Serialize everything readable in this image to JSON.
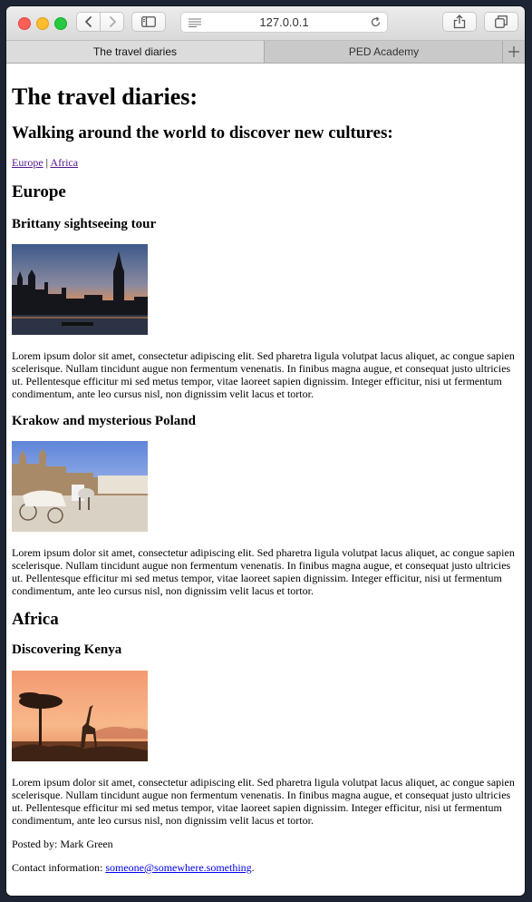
{
  "browser": {
    "url": "127.0.0.1",
    "tabs": [
      {
        "label": "The travel diaries",
        "active": true
      },
      {
        "label": "PED Academy",
        "active": false
      }
    ]
  },
  "page": {
    "title": "The travel diaries:",
    "subtitle": "Walking around the world to discover new cultures:",
    "nav": {
      "europe": "Europe",
      "separator": "|",
      "africa": "Africa"
    },
    "sections": {
      "europe": {
        "heading": "Europe",
        "posts": [
          {
            "title": "Brittany sightseeing tour",
            "image": "london-westminster-sunset",
            "text": "Lorem ipsum dolor sit amet, consectetur adipiscing elit. Sed pharetra ligula volutpat lacus aliquet, ac congue sapien scelerisque. Nullam tincidunt augue non fermentum venenatis. In finibus magna augue, et consequat justo ultricies ut. Pellentesque efficitur mi sed metus tempor, vitae laoreet sapien dignissim. Integer efficitur, nisi ut fermentum condimentum, ante leo cursus nisl, non dignissim velit lacus et tortor."
          },
          {
            "title": "Krakow and mysterious Poland",
            "image": "krakow-horse-carriage",
            "text": "Lorem ipsum dolor sit amet, consectetur adipiscing elit. Sed pharetra ligula volutpat lacus aliquet, ac congue sapien scelerisque. Nullam tincidunt augue non fermentum venenatis. In finibus magna augue, et consequat justo ultricies ut. Pellentesque efficitur mi sed metus tempor, vitae laoreet sapien dignissim. Integer efficitur, nisi ut fermentum condimentum, ante leo cursus nisl, non dignissim velit lacus et tortor."
          }
        ]
      },
      "africa": {
        "heading": "Africa",
        "posts": [
          {
            "title": "Discovering Kenya",
            "image": "kenya-giraffe-sunset",
            "text": "Lorem ipsum dolor sit amet, consectetur adipiscing elit. Sed pharetra ligula volutpat lacus aliquet, ac congue sapien scelerisque. Nullam tincidunt augue non fermentum venenatis. In finibus magna augue, et consequat justo ultricies ut. Pellentesque efficitur mi sed metus tempor, vitae laoreet sapien dignissim. Integer efficitur, nisi ut fermentum condimentum, ante leo cursus nisl, non dignissim velit lacus et tortor."
          }
        ]
      }
    },
    "footer": {
      "posted_by": "Posted by: Mark Green",
      "contact_label": "Contact information:",
      "email": "someone@somewhere.something",
      "contact_end": "."
    }
  },
  "colors": {
    "visited_link": "#551a8b",
    "link": "#0000ee",
    "desktop": "#1d2433"
  }
}
